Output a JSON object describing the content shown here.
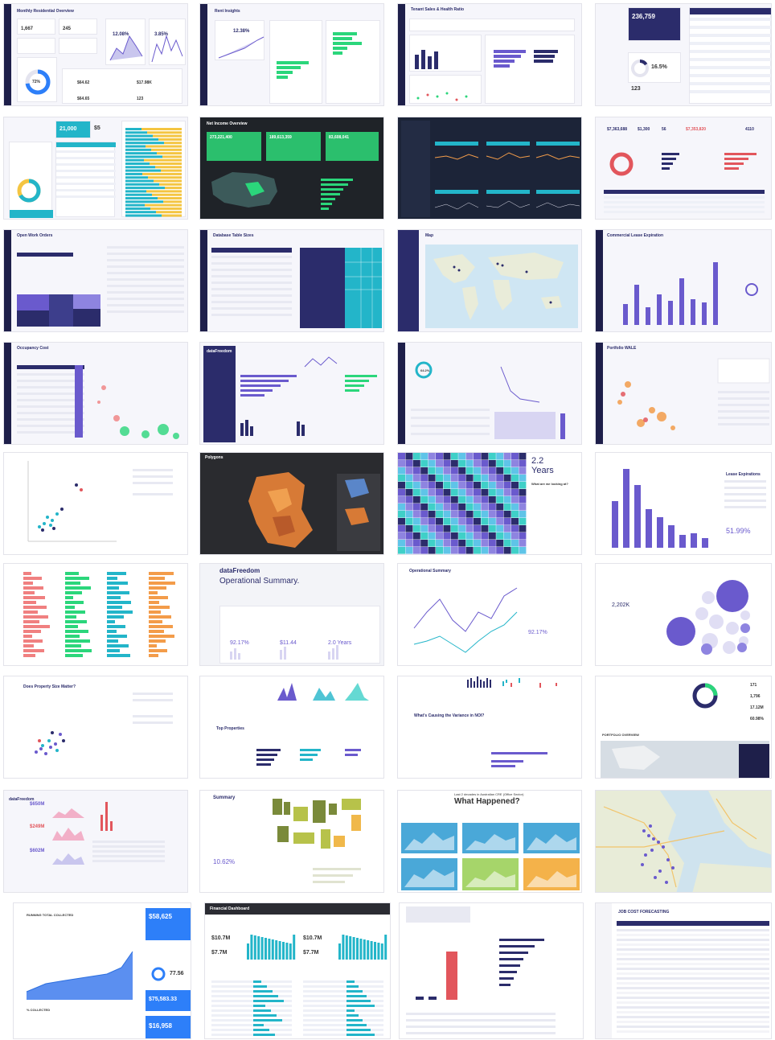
{
  "tiles": {
    "r1c1": {
      "title": "Monthly Residential Overview",
      "kpi_a": "1,667",
      "kpi_b": "245",
      "pct_a": "12.08%",
      "pct_b": "3.85%",
      "donut": "72%",
      "v1": "$64.62",
      "v2": "$17.98K",
      "v3": "$64.65",
      "v4": "123"
    },
    "r1c2": {
      "title": "Rent Insights",
      "pct": "12.38%"
    },
    "r1c3": {
      "title": "Tenant Sales & Health Ratio"
    },
    "r1c4": {
      "big": "236,759",
      "pct": "16.5%",
      "small": "123"
    },
    "r2c1": {
      "kpi": "21,000",
      "kpi2": "$5"
    },
    "r2c2": {
      "title": "Net Income Overview",
      "k1": "273,221,400",
      "k2": "189,613,359",
      "k3": "83,608,041"
    },
    "r2c4": {
      "k1": "$7,363,688",
      "k2": "$1,300",
      "k3": "56",
      "k4": "$7,353,820",
      "k5": "4110"
    },
    "r3c1": {
      "title": "Open Work Orders"
    },
    "r3c2": {
      "title": "Database Table Sizes"
    },
    "r3c3": {
      "title": "Map"
    },
    "r3c4": {
      "title": "Commercial Lease Expiration"
    },
    "r4c1": {
      "title": "Occupancy Cost"
    },
    "r4c2": {
      "logo": "dataFreedom"
    },
    "r4c3": {
      "pct": "64.2%"
    },
    "r4c4": {
      "title": "Portfolio WALE"
    },
    "r5c2": {
      "title": "Polygons"
    },
    "r5c3": {
      "years": "2.2",
      "years_label": "Years",
      "q": "What are we looking at?"
    },
    "r5c4": {
      "title": "Lease Expirations",
      "pct": "51.99%"
    },
    "r6c2": {
      "logo": "dataFreedom",
      "title": "Operational Summary.",
      "k1": "92.17%",
      "k2": "$11.44",
      "k3": "2.0 Years"
    },
    "r6c3": {
      "title": "Operational Summary",
      "pct": "92.17%"
    },
    "r6c4": {
      "val": "2,202K"
    },
    "r7c1": {
      "title": "Does Property Size Matter?"
    },
    "r7c2": {
      "title": "Top Properties"
    },
    "r7c3": {
      "title": "What's Causing the Variance in NOI?"
    },
    "r7c4": {
      "title": "PORTFOLIO OVERVIEW",
      "v1": "171",
      "v2": "1,796",
      "v3": "17.12M",
      "v4": "60.98%"
    },
    "r8c1": {
      "logo": "dataFreedom",
      "k1": "$650M",
      "k2": "$249M",
      "k3": "$602M"
    },
    "r8c2": {
      "title": "Summary",
      "pct": "10.62%"
    },
    "r8c3": {
      "subtitle": "Last 2 decades in Australian CRE (Office Sector)",
      "title": "What Happened?"
    },
    "r9c1": {
      "title": "RUNNING TOTAL COLLECTED",
      "k1": "$58,625",
      "k2": "77.56",
      "k3": "$75,583.33",
      "k4": "$16,958",
      "k5": "% COLLECTED"
    },
    "r9c2": {
      "title": "Financial Dashboard",
      "k1": "$10.7M",
      "k2": "$7.7M",
      "k3": "$10.7M",
      "k4": "$7.7M"
    },
    "r9c4": {
      "title": "JOB COST FORECASTING"
    }
  },
  "colors": {
    "navy": "#2b2c6b",
    "purple": "#6a5acd",
    "green": "#2bd67b",
    "teal": "#23b5c9",
    "blue": "#2d7ff9",
    "orange": "#f39c4a",
    "red": "#e2565c",
    "yellow": "#f4c542",
    "dark": "#1f2328"
  }
}
